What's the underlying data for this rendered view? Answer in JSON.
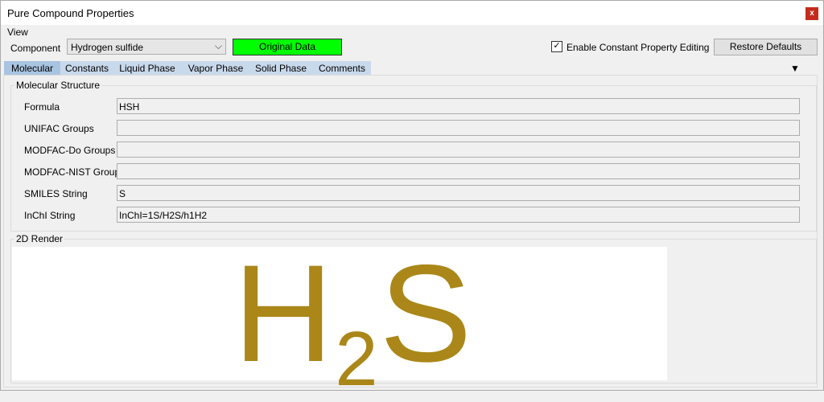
{
  "window": {
    "title": "Pure Compound Properties",
    "close_label": "x"
  },
  "view_label": "View",
  "component": {
    "label": "Component",
    "value": "Hydrogen sulfide"
  },
  "original_data_label": "Original Data",
  "enable_editing": {
    "label": "Enable Constant Property Editing",
    "checked": true,
    "mark": "✓"
  },
  "restore_defaults_label": "Restore Defaults",
  "tabs": [
    {
      "label": "Molecular",
      "active": true
    },
    {
      "label": "Constants"
    },
    {
      "label": "Liquid Phase"
    },
    {
      "label": "Vapor Phase"
    },
    {
      "label": "Solid Phase"
    },
    {
      "label": "Comments"
    }
  ],
  "molecular_structure": {
    "title": "Molecular Structure",
    "rows": [
      {
        "label": "Formula",
        "value": "HSH"
      },
      {
        "label": "UNIFAC Groups",
        "value": ""
      },
      {
        "label": "MODFAC-Do Groups",
        "value": ""
      },
      {
        "label": "MODFAC-NIST Groups",
        "value": ""
      },
      {
        "label": "SMILES String",
        "value": "S"
      },
      {
        "label": "InChI String",
        "value": "InChI=1S/H2S/h1H2"
      }
    ]
  },
  "render": {
    "title": "2D Render",
    "formula_main": "H",
    "formula_sub": "2",
    "formula_tail": "S",
    "color": "#aa8718"
  },
  "icons": {
    "close": "close-icon",
    "dropdown": "chevron-down-icon",
    "overflow": "overflow-arrow-icon"
  }
}
